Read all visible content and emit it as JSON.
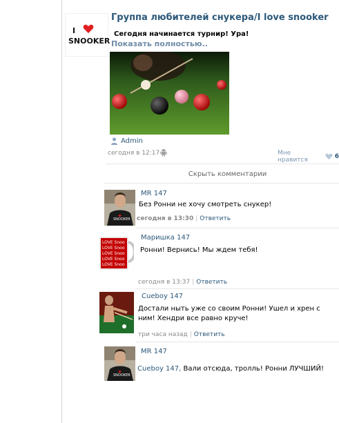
{
  "post": {
    "group_name": "Группа любителей снукера/I love snooker",
    "text": "Сегодня начинается турнир! Ура!",
    "show_more": "Показать полностью..",
    "avatar_i": "I",
    "avatar_snooker": "SNOOKER",
    "author": "Admin",
    "time": "сегодня в 12:17",
    "likes_label": "Мне нравится",
    "likes_count": "6"
  },
  "comments_toggle": "Скрыть комментарии",
  "reply_label": "Ответить",
  "comments": [
    {
      "author": "MR 147",
      "text": "Без Ронни не хочу смотреть снукер!",
      "time": "сегодня в 13:30"
    },
    {
      "author": "Маришка 147",
      "text": "Ронни! Вернись! Мы ждем тебя!",
      "time": "сегодня в 13:37"
    },
    {
      "author": "Cueboy 147",
      "text": "Достали ныть уже со своим Ронни! Ушел и хрен с ним! Хендри все равно круче!",
      "time": "три часа назад"
    },
    {
      "author": "MR 147",
      "mention": "Cueboy 147,",
      "text": " Вали отсюда, тролль! Ронни ЛУЧШИЙ!"
    }
  ],
  "colors": {
    "link": "#2b587a",
    "muted": "#888888",
    "heart": "#e02020"
  },
  "icons": [
    "heart-icon",
    "user-icon",
    "android-icon",
    "like-heart-icon"
  ]
}
